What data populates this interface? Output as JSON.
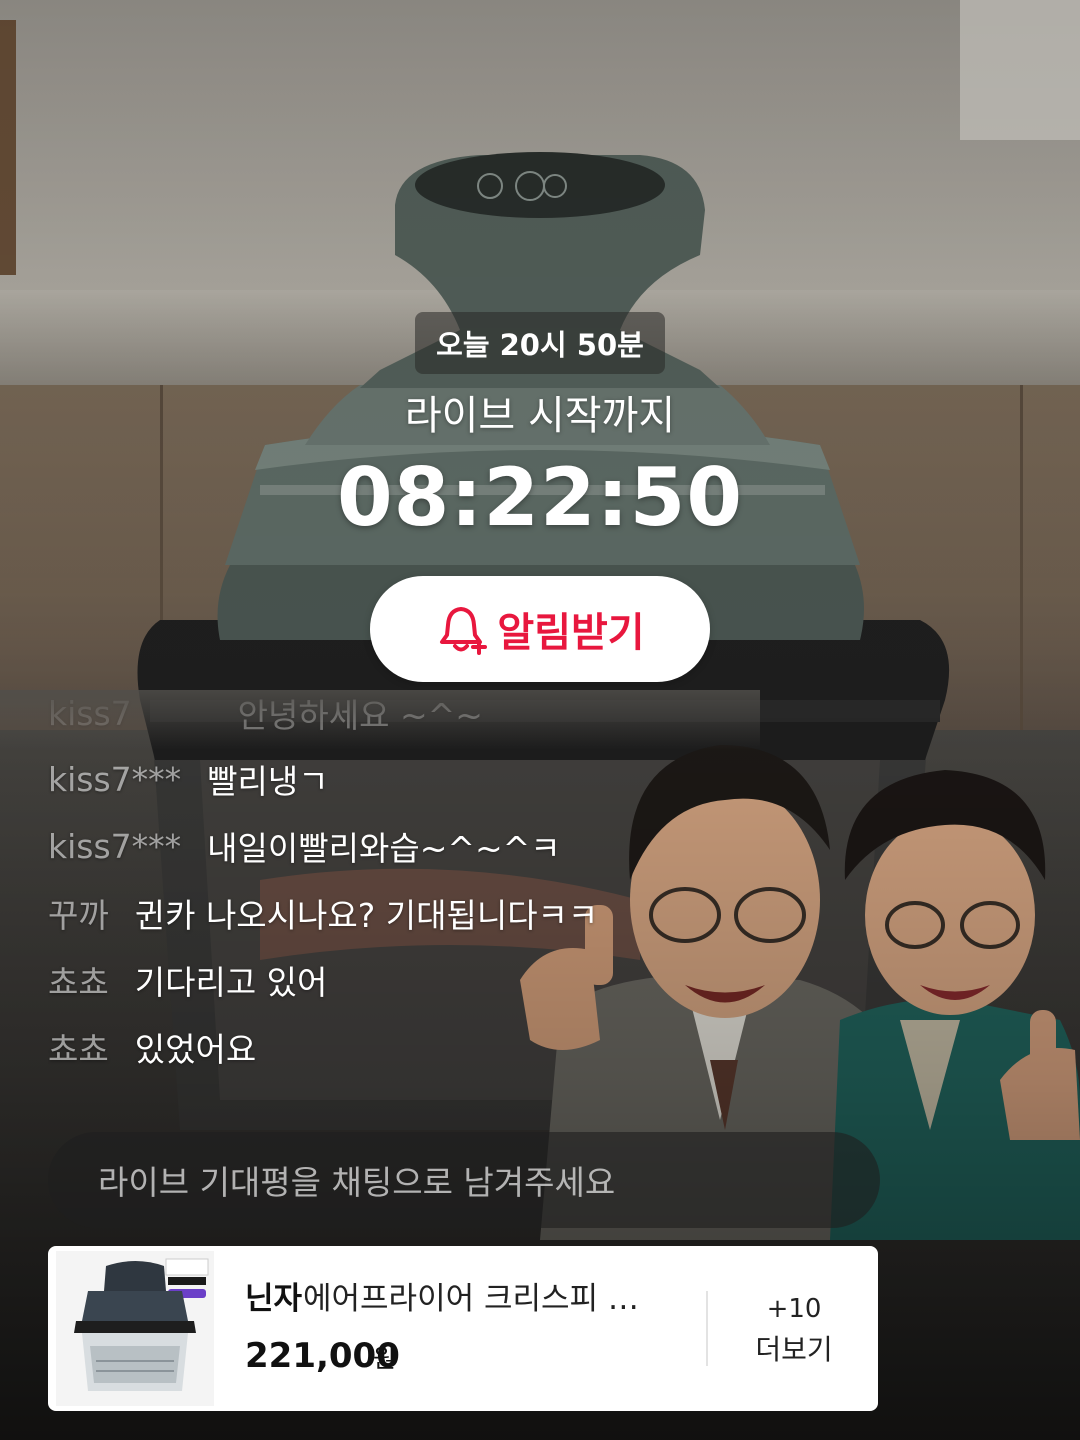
{
  "countdown": {
    "date_text": "오늘 20시 50분",
    "until_label": "라이브 시작까지",
    "time_remaining": "08:22:50"
  },
  "notify_button": {
    "label": "알림받기",
    "accent_color": "#e8173e"
  },
  "chat": {
    "partial_top_message": {
      "user": "kiss7",
      "message": "안녕하세요 ~^~"
    },
    "messages": [
      {
        "user": "kiss7***",
        "message": "빨리냉ㄱ"
      },
      {
        "user": "kiss7***",
        "message": "내일이빨리와습~^~^ㅋ"
      },
      {
        "user": "꾸까",
        "message": "귄카 나오시나요? 기대됩니다ㅋㅋ"
      },
      {
        "user": "쵸쵸",
        "message": "기다리고 있어"
      },
      {
        "user": "쵸쵸",
        "message": "있었어요"
      }
    ],
    "input_placeholder": "라이브 기대평을 채팅으로 남겨주세요"
  },
  "product": {
    "brand": "닌자",
    "name": "에어프라이어 크리스피 올인...",
    "price": "221,000",
    "currency": "원",
    "more_count": "+10",
    "more_label": "더보기"
  },
  "icons": {
    "bell": "bell-plus-icon"
  }
}
